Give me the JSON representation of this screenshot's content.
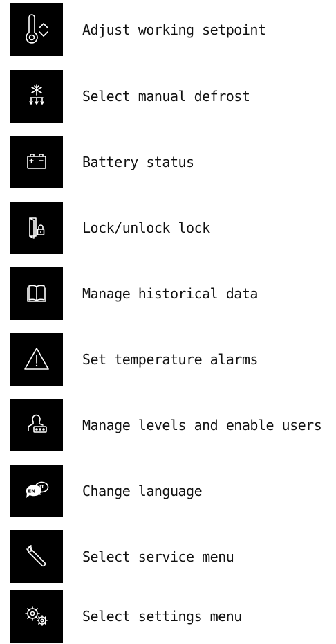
{
  "menu": {
    "items": [
      {
        "label": "Adjust working setpoint",
        "icon": "thermometer-adjust-icon"
      },
      {
        "label": "Select manual defrost",
        "icon": "defrost-icon"
      },
      {
        "label": "Battery status",
        "icon": "battery-icon"
      },
      {
        "label": "Lock/unlock lock",
        "icon": "door-lock-icon"
      },
      {
        "label": "Manage historical data",
        "icon": "book-icon"
      },
      {
        "label": "Set temperature alarms",
        "icon": "warning-icon"
      },
      {
        "label": "Manage levels and enable users",
        "icon": "user-password-icon"
      },
      {
        "label": "Change language",
        "icon": "language-icon"
      },
      {
        "label": "Select service menu",
        "icon": "wrench-icon"
      },
      {
        "label": "Select settings menu",
        "icon": "gears-icon"
      }
    ]
  },
  "colors": {
    "icon_background": "#000000",
    "icon_foreground": "#ffffff",
    "text": "#111111",
    "page_background": "#ffffff"
  }
}
